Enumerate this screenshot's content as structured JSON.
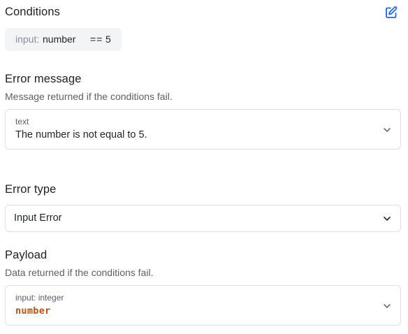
{
  "conditions": {
    "title": "Conditions",
    "edit_icon": "edit-icon",
    "condition": {
      "input_label": "input:",
      "variable": "number",
      "operator": "==",
      "value": "5"
    }
  },
  "error_message": {
    "title": "Error message",
    "description": "Message returned if the conditions fail.",
    "field": {
      "type_label": "text",
      "value": "The number is not equal to 5."
    }
  },
  "error_type": {
    "title": "Error type",
    "selected": "Input Error"
  },
  "payload": {
    "title": "Payload",
    "description": "Data returned if the conditions fail.",
    "field": {
      "type_label": "input: integer",
      "value": "number"
    }
  },
  "colors": {
    "code_accent": "#b5561a",
    "edit_icon": "#2563eb",
    "chip_bg": "#f3f4f6",
    "border": "#dcdfe4"
  }
}
